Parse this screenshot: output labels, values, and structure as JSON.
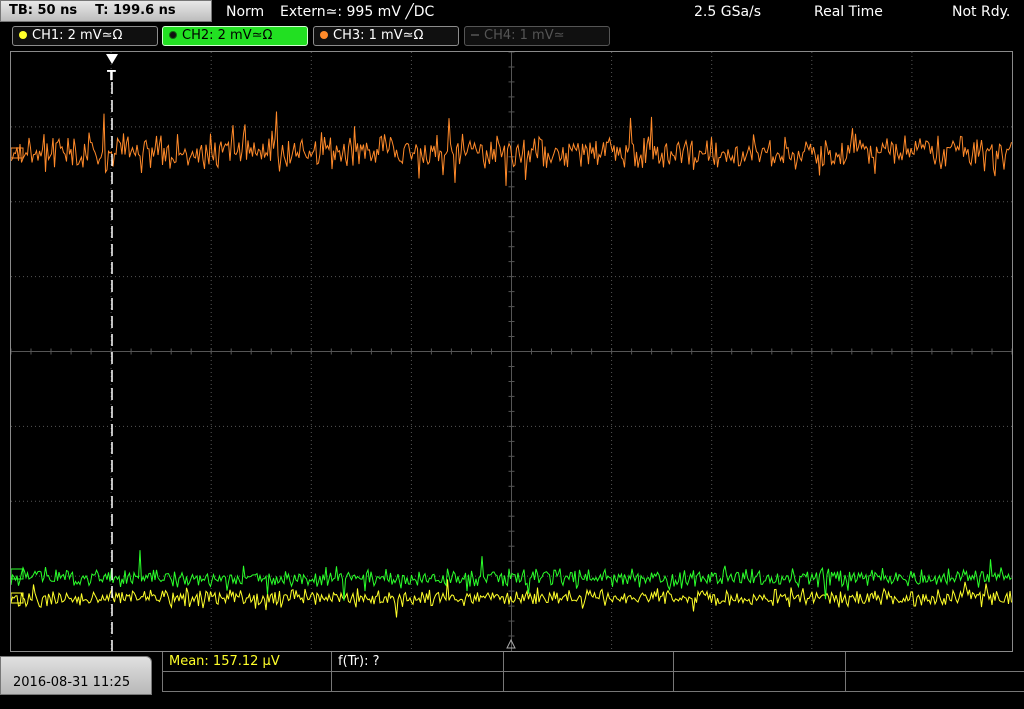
{
  "header": {
    "timebase": "TB: 50 ns",
    "trigger_time": "T: 199.6 ns",
    "trigger_mode": "Norm",
    "trigger_source": "Extern≃: 995 mV ╱DC",
    "sample_rate": "2.5 GSa/s",
    "acq_mode": "Real Time",
    "status": "Not Rdy."
  },
  "channels": [
    {
      "label": "CH1: 2 mV≃Ω",
      "color": "#ffff2a",
      "state": "on"
    },
    {
      "label": "CH2: 2 mV≃Ω",
      "color": "#2aff2a",
      "state": "active"
    },
    {
      "label": "CH3: 1 mV≃Ω",
      "color": "#ff8a2a",
      "state": "on"
    },
    {
      "label": "CH4: 1 mV≃",
      "color": "#555555",
      "state": "off"
    }
  ],
  "trigger_marker": "T",
  "datetime": "2016-08-31 11:25",
  "measurements": {
    "mean": "Mean: 157.12 µV",
    "freq": "f(Tr): ?"
  },
  "colors": {
    "ch1": "#ffff2a",
    "ch2": "#2aff2a",
    "ch3": "#ff8a2a",
    "grid": "#555555",
    "trigger_line": "#ffffff"
  },
  "icons": [
    "trigger-marker-icon",
    "channel-dot-icon",
    "trigger-level-arrow-icon"
  ]
}
